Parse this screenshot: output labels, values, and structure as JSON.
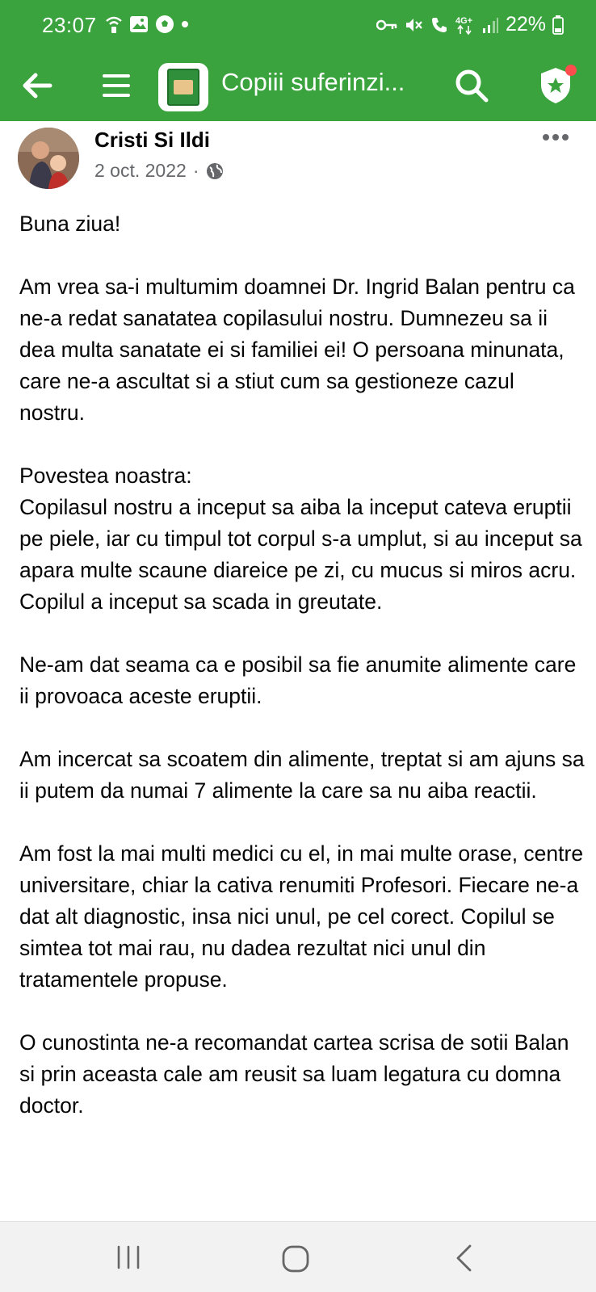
{
  "status_bar": {
    "time": "23:07",
    "battery_pct": "22%",
    "network": "4G+",
    "left_icons": [
      "wifi-calling-icon",
      "gallery-icon",
      "soccer-ball-icon",
      "dot-icon"
    ],
    "right_icons": [
      "vpn-key-icon",
      "mute-icon",
      "call-icon",
      "network-4g-icon",
      "signal-icon",
      "battery-icon"
    ]
  },
  "app_bar": {
    "group_title": "Copiii suferinzi...",
    "color": "#3aa33d"
  },
  "post": {
    "author": "Cristi Si Ildi",
    "date": "2 oct. 2022",
    "separator": "·",
    "privacy_icon": "globe-icon",
    "paragraphs": [
      "Buna ziua!",
      "Am vrea sa-i multumim doamnei Dr. Ingrid Balan pentru ca ne-a redat sanatatea copilasului nostru. Dumnezeu sa ii dea multa sanatate ei si familiei ei! O persoana minunata, care ne-a ascultat si a stiut cum sa gestioneze cazul nostru.",
      "Povestea noastra:\nCopilasul nostru a inceput sa aiba la inceput cateva eruptii pe piele, iar cu timpul tot corpul s-a umplut, si au inceput sa apara multe scaune diareice pe zi, cu mucus si miros acru. Copilul a inceput sa scada in greutate.",
      "Ne-am dat seama ca e posibil sa fie anumite alimente care ii provoaca aceste eruptii.",
      "Am incercat sa scoatem din alimente, treptat si am ajuns sa ii putem da numai 7 alimente la care sa nu aiba reactii.",
      "Am fost la mai multi medici cu el, in mai multe orase, centre universitare, chiar la cativa renumiti Profesori. Fiecare ne-a dat alt diagnostic, insa nici unul, pe cel corect. Copilul se simtea tot mai rau, nu dadea rezultat nici unul din tratamentele propuse.",
      "O cunostinta ne-a recomandat cartea scrisa de sotii Balan si prin aceasta cale am reusit sa luam legatura cu domna doctor."
    ]
  },
  "nav_bar": {
    "icons": [
      "recents-icon",
      "home-icon",
      "back-nav-icon"
    ]
  }
}
